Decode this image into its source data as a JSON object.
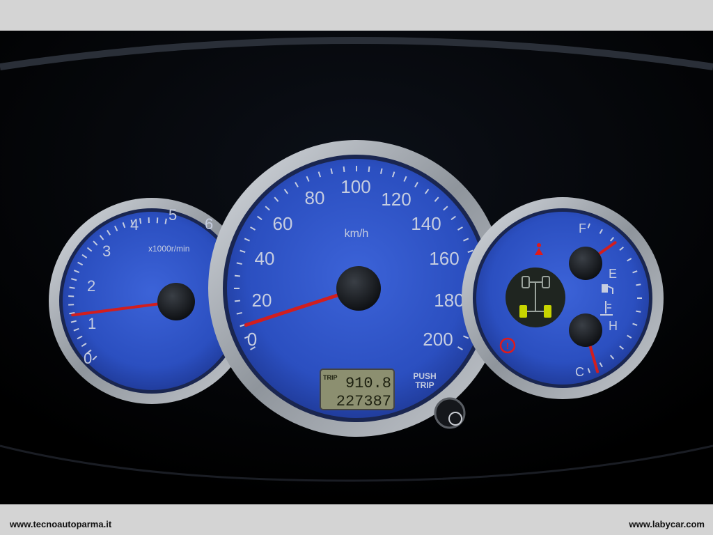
{
  "speedometer": {
    "labels": [
      "0",
      "20",
      "40",
      "60",
      "80",
      "100",
      "120",
      "140",
      "160",
      "180",
      "200"
    ],
    "unit": "km/h",
    "value": 10,
    "max": 200,
    "trip_label": "TRIP",
    "trip_value": "910.8",
    "odometer_value": "227387",
    "push_label": "PUSH",
    "trip_button_label": "TRIP"
  },
  "tachometer": {
    "labels": [
      "0",
      "1",
      "2",
      "3",
      "4",
      "5",
      "6"
    ],
    "unit": "x1000r/min",
    "value": 0.9,
    "max": 6
  },
  "fuel_gauge": {
    "full_label": "F",
    "empty_label": "E",
    "level": 0.9
  },
  "temp_gauge": {
    "hot_label": "H",
    "cold_label": "C",
    "level": 0.2
  },
  "footer": {
    "left": "www.tecnoautoparma.it",
    "right": "www.labycar.com"
  },
  "colors": {
    "dial": "#2f55c9",
    "needle": "#d21e1e",
    "bezel": "#a8adb4",
    "warning": "#e01a1a",
    "indicator": "#c7d400"
  }
}
